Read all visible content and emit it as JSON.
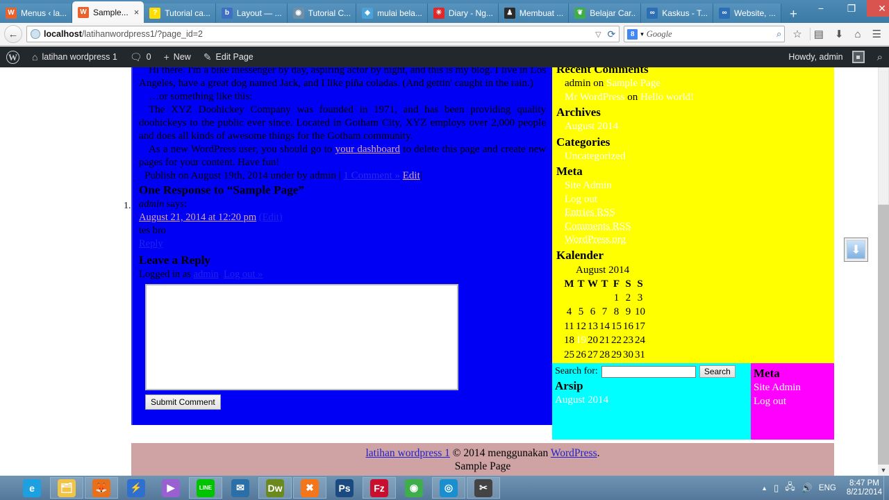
{
  "browser": {
    "tabs": [
      {
        "label": "Menus ‹ la...",
        "favicon": "wordpress-icon",
        "favicon_bg": "#e8622d",
        "favicon_glyph": "W",
        "active": false
      },
      {
        "label": "Sample...",
        "favicon": "wordpress-icon",
        "favicon_bg": "#e8622d",
        "favicon_glyph": "W",
        "active": true,
        "close": "×"
      },
      {
        "label": "Tutorial ca...",
        "favicon": "question-icon",
        "favicon_bg": "#ffdd00",
        "favicon_glyph": "?",
        "active": false
      },
      {
        "label": "Layout — ...",
        "favicon": "blogger-icon",
        "favicon_bg": "#3d6fc4",
        "favicon_glyph": "b",
        "active": false
      },
      {
        "label": "Tutorial C...",
        "favicon": "globe-icon",
        "favicon_bg": "#6e8fa5",
        "favicon_glyph": "◉",
        "active": false
      },
      {
        "label": "mulai bela...",
        "favicon": "shield-icon",
        "favicon_bg": "#4aa3d8",
        "favicon_glyph": "◈",
        "active": false
      },
      {
        "label": "Diary - Ng...",
        "favicon": "star-icon",
        "favicon_bg": "#e02828",
        "favicon_glyph": "✳",
        "active": false
      },
      {
        "label": "Membuat ...",
        "favicon": "person-icon",
        "favicon_bg": "#2b2b2b",
        "favicon_glyph": "♟",
        "active": false
      },
      {
        "label": "Belajar Car...",
        "favicon": "leaf-icon",
        "favicon_bg": "#3fae4a",
        "favicon_glyph": "❦",
        "active": false
      },
      {
        "label": "Kaskus - T...",
        "favicon": "kaskus-icon",
        "favicon_bg": "#2d6fb5",
        "favicon_glyph": "∞",
        "active": false
      },
      {
        "label": "Website, ...",
        "favicon": "kaskus-icon",
        "favicon_bg": "#2d6fb5",
        "favicon_glyph": "∞",
        "active": false
      }
    ],
    "new_tab_label": "+",
    "window_controls": {
      "minimize": "−",
      "restore": "❐",
      "close": "✕"
    },
    "back_arrow": "←",
    "url": {
      "host": "localhost",
      "path": "/latihanwordpress1/?page_id=2"
    },
    "url_dropmarker": "▽",
    "reload": "⟳",
    "search_engine": "Google",
    "search_engine_glyph": "8",
    "search_mag": "⌕",
    "toolbar_icons": [
      "bookmark-star-icon",
      "reader-icon",
      "downloads-icon",
      "home-icon",
      "menu-icon"
    ],
    "toolbar_glyphs": [
      "☆",
      "▤",
      "⬇",
      "⌂",
      "☰"
    ]
  },
  "wp_admin_bar": {
    "logo": "W",
    "home_glyph": "⌂",
    "site_name": "latihan wordpress 1",
    "comments_glyph": "💬",
    "comments_count": "0",
    "new_glyph": "+",
    "new_label": "New",
    "edit_glyph": "✎",
    "edit_label": "Edit Page",
    "howdy": "Howdy, admin",
    "search_glyph": "⌕"
  },
  "content": {
    "paragraph_cut": "Hi there. I'm a bike messenger by day, aspiring actor by night, and this is my blog. I live in Los Angeles, have a great dog named Jack, and I like piña coladas. (And gettin' caught in the rain.)",
    "paragraph_or": "…or something like this:",
    "paragraph_xyz": "The XYZ Doohickey Company was founded in 1971, and has been providing quality doohickeys to the public ever since. Located in Gotham City, XYZ employs over 2,000 people and does all kinds of awesome things for the Gotham community.",
    "paragraph_new_user_pre": "As a new WordPress user, you should go to ",
    "dashboard_link": "your dashboard",
    "paragraph_new_user_post": " to delete this page and create new pages for your content. Have fun!",
    "publish_meta": "Publish on August 19th, 2014 under by admin |",
    "comment_link": "1 Comment »",
    "edit_link": "Edit",
    "responses_heading": "One Response to “Sample Page”",
    "comment": {
      "marker": "1.",
      "author": "admin",
      "says": " says:",
      "date": "August 21, 2014 at 12:20 pm",
      "edit": "(Edit)",
      "body": "tes bro",
      "reply": "Reply"
    },
    "reply_heading": "Leave a Reply",
    "logged_in_pre": "Logged in as ",
    "logged_in_user": "admin",
    "logged_in_sep": ". ",
    "log_out_link": "Log out »",
    "comment_textarea_value": "",
    "submit_label": "Submit Comment"
  },
  "sidebar": {
    "recent_comments": {
      "heading": "Recent Comments",
      "items": [
        {
          "author": "admin",
          "on": " on ",
          "post": "Sample Page"
        },
        {
          "author": "Mr WordPress",
          "on": " on ",
          "post": "Hello world!"
        }
      ]
    },
    "archives": {
      "heading": "Archives",
      "items": [
        "August 2014"
      ]
    },
    "categories": {
      "heading": "Categories",
      "items": [
        "Uncategorized"
      ]
    },
    "meta": {
      "heading": "Meta",
      "items": [
        "Site Admin",
        "Log out",
        "Entries RSS",
        "Comments RSS",
        "WordPress.org"
      ]
    },
    "calendar": {
      "heading": "Kalender",
      "caption": "August 2014",
      "weekdays": [
        "M",
        "T",
        "W",
        "T",
        "F",
        "S",
        "S"
      ],
      "weeks": [
        [
          "",
          "",
          "",
          "",
          "1",
          "2",
          "3"
        ],
        [
          "4",
          "5",
          "6",
          "7",
          "8",
          "9",
          "10"
        ],
        [
          "11",
          "12",
          "13",
          "14",
          "15",
          "16",
          "17"
        ],
        [
          "18",
          "19",
          "20",
          "21",
          "22",
          "23",
          "24"
        ],
        [
          "25",
          "26",
          "27",
          "28",
          "29",
          "30",
          "31"
        ]
      ],
      "linked_day": "19"
    }
  },
  "footer_widgets": {
    "search": {
      "label": "Search for:",
      "value": "",
      "button": "Search"
    },
    "arsip": {
      "heading": "Arsip",
      "items": [
        "August 2014"
      ]
    },
    "meta": {
      "heading": "Meta",
      "items": [
        "Site Admin",
        "Log out"
      ]
    }
  },
  "footer": {
    "site_link": "latihan wordpress 1",
    "copyright": " © 2014 menggunakan ",
    "wordpress_link": "WordPress",
    "period": ".",
    "page_name": "Sample Page"
  },
  "float_button": {
    "name": "scroll-down-button",
    "glyph": "⬇"
  },
  "scrollbar": {
    "down_arrow": "▼"
  },
  "taskbar": {
    "items": [
      {
        "name": "internet-explorer",
        "glyph": "e",
        "color": "#1ca0e0",
        "boxed": false
      },
      {
        "name": "file-explorer",
        "glyph": "🗂",
        "color": "#f0c34a",
        "boxed": true
      },
      {
        "name": "firefox",
        "glyph": "🦊",
        "color": "#e8701a",
        "boxed": true
      },
      {
        "name": "idm-downloader",
        "glyph": "⚡",
        "color": "#2f6fd0",
        "boxed": false
      },
      {
        "name": "media-player",
        "glyph": "▶",
        "color": "#9a5fd0",
        "boxed": false
      },
      {
        "name": "line-messenger",
        "glyph": "LINE",
        "color": "#00c300",
        "boxed": true
      },
      {
        "name": "thunderbird",
        "glyph": "✉",
        "color": "#2a6fa8",
        "boxed": false
      },
      {
        "name": "dreamweaver",
        "glyph": "Dw",
        "color": "#6b8a1e",
        "boxed": true
      },
      {
        "name": "xampp",
        "glyph": "✖",
        "color": "#f4761a",
        "boxed": true
      },
      {
        "name": "photoshop",
        "glyph": "Ps",
        "color": "#1b4a80",
        "boxed": false
      },
      {
        "name": "filezilla",
        "glyph": "Fz",
        "color": "#c8102e",
        "boxed": true
      },
      {
        "name": "chrome",
        "glyph": "◉",
        "color": "#3fae4a",
        "boxed": false
      },
      {
        "name": "deepfreeze",
        "glyph": "◎",
        "color": "#1a8fd0",
        "boxed": true
      },
      {
        "name": "snipping-tool",
        "glyph": "✂",
        "color": "#444444",
        "boxed": true
      }
    ],
    "tray": {
      "expand": "▲",
      "icons": [
        "battery-icon",
        "network-icon",
        "volume-icon"
      ],
      "glyphs": [
        "▯",
        "🖧",
        "🔊"
      ],
      "language": "ENG",
      "time": "8:47 PM",
      "date": "8/21/2014"
    }
  },
  "colors": {
    "content_bg": "#0000f5",
    "sidebar_bg": "#ffff00",
    "footer_widget_cyan": "#00ffff",
    "footer_widget_magenta": "#ff00ff",
    "footer_bg": "#cfa3a3",
    "admin_bar": "#23282d"
  }
}
